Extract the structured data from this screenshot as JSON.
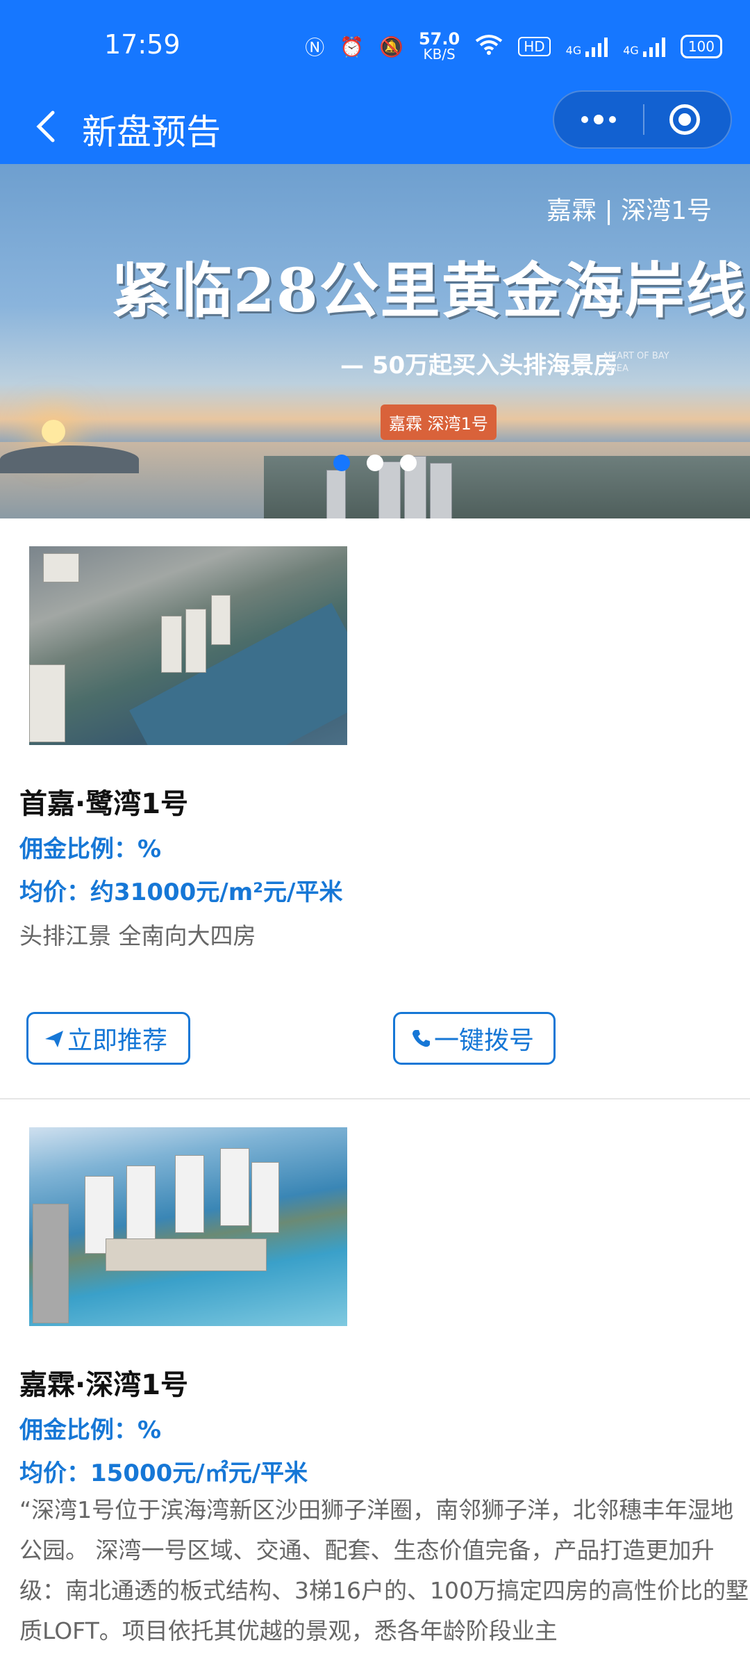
{
  "status_bar": {
    "time": "17:59",
    "net_speed_value": "57.0",
    "net_speed_unit": "KB/S",
    "hd_label": "HD",
    "sig1_label": "4G",
    "sig2_label": "4G",
    "battery": "100"
  },
  "nav": {
    "title": "新盘预告"
  },
  "banner": {
    "brand": "嘉霖 | 深湾1号",
    "headline": "紧临28公里黄金海岸线",
    "subline": "— 50万起买入头排海景房",
    "en_line1": "HEART OF BAY",
    "en_line2": "AREA",
    "tag": "嘉霖 深湾1号",
    "active_dot": 0,
    "dot_count": 3
  },
  "listings": [
    {
      "name": "首嘉·鹭湾1号",
      "commission": "佣金比例：%",
      "price": "均价：约31000元/m²元/平米",
      "desc": "头排江景 全南向大四房",
      "recommend_label": "立即推荐",
      "call_label": "一键拨号"
    },
    {
      "name": "嘉霖·深湾1号",
      "commission": "佣金比例：%",
      "price": "均价：15000元/㎡元/平米",
      "desc": "“深湾1号位于滨海湾新区沙田狮子洋圈，南邻狮子洋，北邻穗丰年湿地公园。 深湾一号区域、交通、配套、生态价值完备，产品打造更加升级：南北通透的板式结构、3梯16户的、100万搞定四房的高性价比的墅质LOFT。项目依托其优越的景观，悉各年龄阶段业主"
    }
  ],
  "colors": {
    "primary": "#1677ff",
    "link_blue": "#1677d6",
    "text_gray": "#666666"
  }
}
